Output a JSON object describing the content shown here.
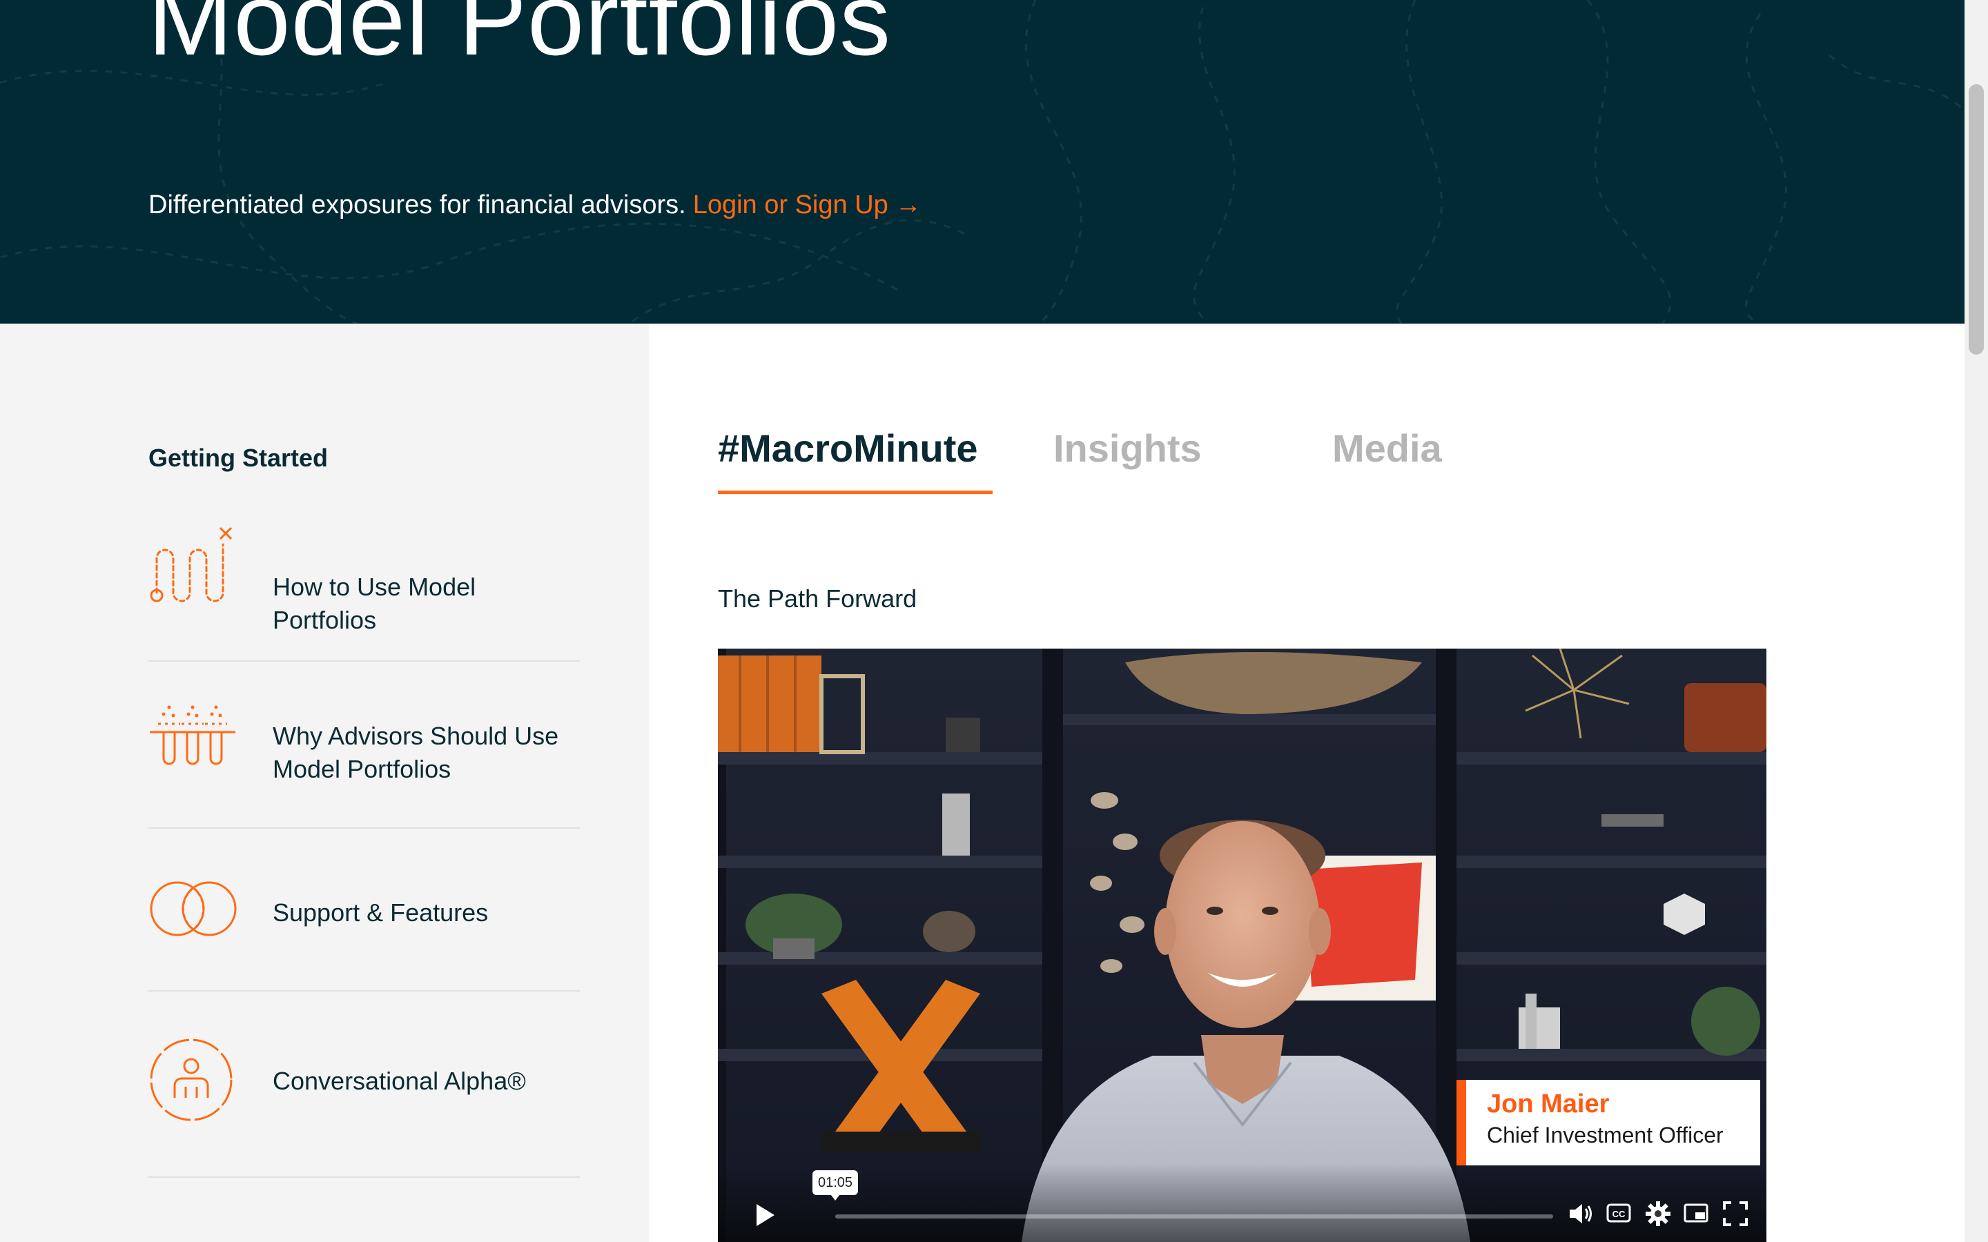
{
  "hero": {
    "title": "Model Portfolios",
    "subtitle": "Differentiated exposures for financial advisors.",
    "login_link": "Login or Sign Up",
    "login_arrow": "→"
  },
  "sidebar": {
    "heading": "Getting Started",
    "items": [
      {
        "label": "How to Use Model Portfolios",
        "icon": "path-route-icon"
      },
      {
        "label": "Why Advisors Should Use Model Portfolios",
        "icon": "test-tubes-icon"
      },
      {
        "label": "Support & Features",
        "icon": "overlapping-circles-icon"
      },
      {
        "label": "Conversational Alpha®",
        "icon": "person-circle-icon"
      }
    ]
  },
  "main": {
    "tabs": [
      {
        "label": "#MacroMinute",
        "active": true
      },
      {
        "label": "Insights",
        "active": false
      },
      {
        "label": "Media",
        "active": false
      }
    ],
    "video_title": "The Path Forward"
  },
  "video": {
    "speaker_name": "Jon Maier",
    "speaker_role": "Chief Investment Officer",
    "timestamp": "01:05",
    "progress_fraction": 0,
    "controls": [
      "play-icon",
      "volume-icon",
      "captions-icon",
      "settings-icon",
      "picture-in-picture-icon",
      "fullscreen-icon"
    ]
  },
  "colors": {
    "hero_bg": "#022a35",
    "accent": "#ff6a13",
    "sidebar_bg": "#f4f4f4",
    "text_dark": "#0b2a33",
    "tab_inactive": "#b5b5b5"
  }
}
